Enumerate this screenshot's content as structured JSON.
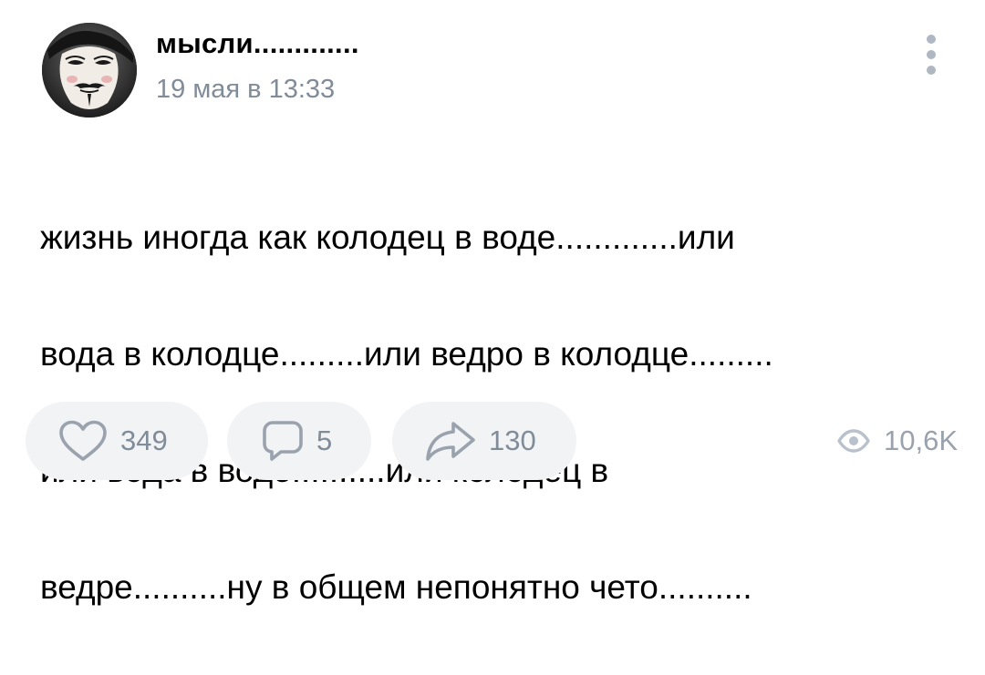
{
  "post": {
    "author": {
      "name": "мысли.............",
      "avatar_icon": "guy-fawkes-mask-avatar"
    },
    "date": "19 мая в 13:33",
    "menu_icon": "more-vertical-icon",
    "text_lines": [
      "жизнь иногда как колодец в воде.............или",
      "вода в колодце.........или ведро в колодце.........",
      "или вода в воде..........или колодец в",
      "ведре..........ну в общем непонятно чето.........."
    ],
    "actions": {
      "likes": {
        "icon": "heart-icon",
        "count": "349"
      },
      "comments": {
        "icon": "comment-icon",
        "count": "5"
      },
      "shares": {
        "icon": "share-arrow-icon",
        "count": "130"
      }
    },
    "views": {
      "icon": "eye-icon",
      "count": "10,6K"
    }
  },
  "colors": {
    "secondary_text": "#818c99",
    "pill_background": "#f2f3f5",
    "icon_gray": "#99a2ad"
  }
}
